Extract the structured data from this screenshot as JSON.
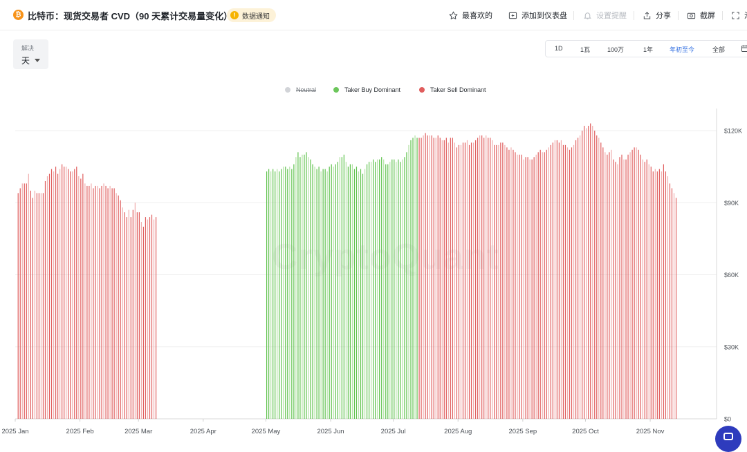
{
  "header": {
    "logo_glyph": "₿",
    "title": "比特币：现货交易者 CVD（90 天累计交易量变化）",
    "alert_badge": "数据通知",
    "alert_glyph": "!",
    "actions": [
      {
        "label": "最喜欢的",
        "icon": "star-icon",
        "enabled": true
      },
      {
        "label": "添加到仪表盘",
        "icon": "dashboard-add-icon",
        "enabled": true
      },
      {
        "label": "设置提醒",
        "icon": "bell-icon",
        "enabled": false
      },
      {
        "label": "分享",
        "icon": "share-icon",
        "enabled": true
      },
      {
        "label": "截屏",
        "icon": "camera-icon",
        "enabled": true
      },
      {
        "label": "渐",
        "icon": "fullscreen-icon",
        "enabled": true
      }
    ]
  },
  "controls": {
    "resolution_label": "解决",
    "resolution_value": "天",
    "ranges": [
      "1D",
      "1瓦",
      "100万",
      "1年",
      "年初至今",
      "全部"
    ],
    "active_range": "年初至今",
    "calendar_icon": "calendar-icon"
  },
  "legend": [
    {
      "label": "Neutral",
      "color": "#d2d4d8",
      "enabled": false
    },
    {
      "label": "Taker Buy Dominant",
      "color": "#6cc65b",
      "enabled": true
    },
    {
      "label": "Taker Sell Dominant",
      "color": "#e05d5d",
      "enabled": true
    }
  ],
  "watermark": "CryptoQuant",
  "colors": {
    "sell_strong": "#e05d5d",
    "sell_light": "#f0aeae",
    "buy_strong": "#5fc24d",
    "buy_light": "#b4e2a6",
    "grid": "#efefef",
    "axis_text": "#4a4f55"
  },
  "chart_data": {
    "type": "bar",
    "title": "比特币：现货交易者 CVD（90 天累计交易量变化）",
    "y_axis_side": "right",
    "ylim": [
      0,
      125000
    ],
    "y_ticks": [
      0,
      30000,
      60000,
      90000,
      120000
    ],
    "y_tick_labels": [
      "$0",
      "$30K",
      "$60K",
      "$90K",
      "$120K"
    ],
    "x_range": [
      "2025-01-01",
      "2025-11-30"
    ],
    "x_ticks": [
      "2025-01-01",
      "2025-02-01",
      "2025-03-01",
      "2025-04-01",
      "2025-05-01",
      "2025-06-01",
      "2025-07-01",
      "2025-08-01",
      "2025-09-01",
      "2025-10-01",
      "2025-11-01"
    ],
    "x_tick_labels": [
      "2025 Jan",
      "2025 Feb",
      "2025 Mar",
      "2025 Apr",
      "2025 May",
      "2025 Jun",
      "2025 Jul",
      "2025 Aug",
      "2025 Sep",
      "2025 Oct",
      "2025 Nov"
    ],
    "grid": true,
    "legend_position": "top-center",
    "series": [
      {
        "name": "Taker Sell Dominant",
        "segments": [
          {
            "start": "2025-01-02",
            "values": [
              94000,
              96000,
              98000,
              98000,
              98000,
              102000,
              95000,
              92000,
              95000,
              94000,
              94000,
              94000,
              94000,
              99000,
              101000,
              102000,
              104000,
              103000,
              105000,
              102000,
              104000,
              106000,
              105000,
              105000,
              104000,
              103000,
              103000,
              104000,
              105000,
              101000,
              100000,
              102000,
              98000,
              97000,
              97000,
              98000,
              96000,
              97000,
              97000,
              96000,
              97000,
              98000,
              97000,
              96000,
              97000,
              96000,
              96000,
              94000,
              93000,
              91000,
              88000,
              86000,
              84000,
              87000,
              84000,
              87000,
              90000,
              86000,
              86000,
              82000,
              80000,
              84000,
              83000,
              84000,
              85000,
              83000,
              84000
            ]
          },
          {
            "start": "2025-07-13",
            "values": [
              117000,
              117000,
              118000,
              119000,
              118000,
              118000,
              118000,
              117000,
              117000,
              118000,
              117000,
              116000,
              116000,
              117000,
              115000,
              117000,
              117000,
              115000,
              113000,
              114000,
              114000,
              115000,
              115000,
              116000,
              114000,
              115000,
              115000,
              116000,
              117000,
              118000,
              118000,
              117000,
              118000,
              117000,
              117000,
              116000,
              114000,
              114000,
              114000,
              115000,
              115000,
              114000,
              113000,
              112000,
              113000,
              112000,
              111000,
              110000,
              110000,
              110000,
              108000,
              109000,
              109000,
              108000,
              108000,
              109000,
              110000,
              111000,
              112000,
              111000,
              111000,
              112000,
              113000,
              114000,
              115000,
              116000,
              116000,
              115000,
              116000,
              114000,
              114000,
              113000,
              112000,
              113000,
              114000,
              116000,
              117000,
              118000,
              120000,
              122000,
              121000,
              122000,
              123000,
              122000,
              120000,
              118000,
              117000,
              115000,
              113000,
              111000,
              110000,
              111000,
              112000,
              108000,
              107000,
              106000,
              109000,
              110000,
              108000,
              108000,
              110000,
              111000,
              112000,
              113000,
              113000,
              112000,
              110000,
              108000,
              107000,
              108000,
              106000,
              105000,
              103000,
              104000,
              103000,
              104000,
              103000,
              106000,
              103000,
              101000,
              98000,
              96000,
              94000,
              92000
            ]
          }
        ]
      },
      {
        "name": "Taker Buy Dominant",
        "segments": [
          {
            "start": "2025-05-01",
            "values": [
              103000,
              104000,
              103000,
              104000,
              103000,
              104000,
              103000,
              104000,
              105000,
              105000,
              104000,
              105000,
              104000,
              106000,
              109000,
              111000,
              109000,
              110000,
              110000,
              111000,
              109000,
              108000,
              106000,
              105000,
              104000,
              105000,
              103000,
              104000,
              104000,
              103000,
              105000,
              106000,
              105000,
              106000,
              107000,
              109000,
              109000,
              110000,
              107000,
              105000,
              106000,
              106000,
              104000,
              105000,
              103000,
              104000,
              102000,
              104000,
              106000,
              107000,
              107000,
              108000,
              107000,
              108000,
              108000,
              109000,
              108000,
              106000,
              106000,
              107000,
              108000,
              108000,
              107000,
              108000,
              107000,
              108000,
              109000,
              111000,
              114000,
              116000,
              117000,
              118000,
              117000
            ]
          }
        ]
      }
    ]
  }
}
